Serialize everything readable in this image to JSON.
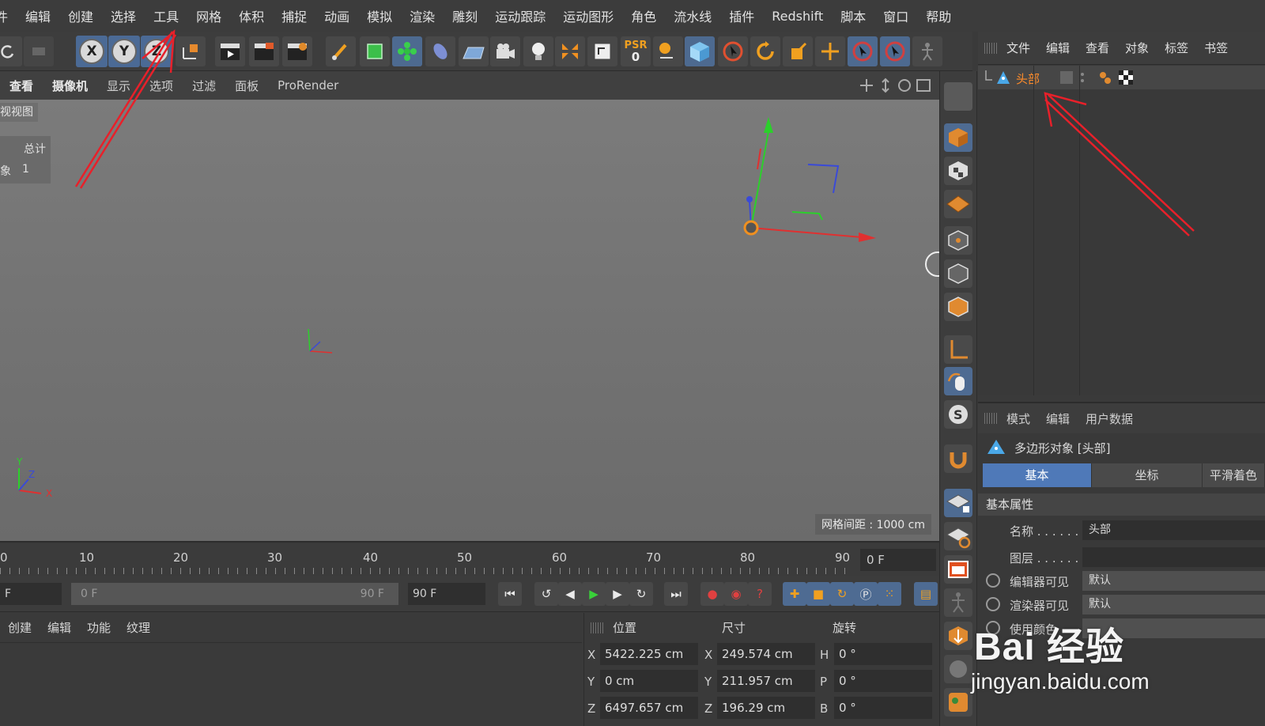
{
  "menubar": [
    "件",
    "编辑",
    "创建",
    "选择",
    "工具",
    "网格",
    "体积",
    "捕捉",
    "动画",
    "模拟",
    "渲染",
    "雕刻",
    "运动跟踪",
    "运动图形",
    "角色",
    "流水线",
    "插件",
    "Redshift",
    "脚本",
    "窗口",
    "帮助"
  ],
  "toolbar": {
    "axis_x": "X",
    "axis_y": "Y",
    "axis_z": "Z",
    "psr_label": "PSR",
    "psr_value": "0"
  },
  "viewport": {
    "menu": [
      "查看",
      "摄像机",
      "显示",
      "选项",
      "过滤",
      "面板",
      "ProRender"
    ],
    "label": "视视图",
    "hud_total": "总计",
    "hud_object": "象",
    "hud_count": "1",
    "grid_spacing": "网格间距 : 1000 cm"
  },
  "object_manager": {
    "menu": [
      "文件",
      "编辑",
      "查看",
      "对象",
      "标签",
      "书签"
    ],
    "object_name": "头部"
  },
  "attribute_manager": {
    "menu": [
      "模式",
      "编辑",
      "用户数据"
    ],
    "title": "多边形对象 [头部]",
    "tabs": [
      "基本",
      "坐标",
      "平滑着色"
    ],
    "section": "基本属性",
    "rows": [
      {
        "label": "名称 . . . . . .",
        "value": "头部"
      },
      {
        "label": "图层 . . . . . .",
        "value": ""
      },
      {
        "label": "编辑器可见",
        "value": "默认"
      },
      {
        "label": "渲染器可见",
        "value": "默认"
      },
      {
        "label": "使用颜色",
        "value": ""
      }
    ]
  },
  "timeline": {
    "ticks": [
      "0",
      "10",
      "20",
      "30",
      "40",
      "50",
      "60",
      "70",
      "80",
      "90"
    ],
    "current_frame": "0 F"
  },
  "transport": {
    "start": "F",
    "range_start": "0 F",
    "range_end": "90 F",
    "end": "90 F"
  },
  "material_manager": {
    "menu": [
      "创建",
      "编辑",
      "功能",
      "纹理"
    ]
  },
  "coordinate_manager": {
    "headers": [
      "位置",
      "尺寸",
      "旋转"
    ],
    "position": {
      "x": "5422.225 cm",
      "y": "0 cm",
      "z": "6497.657 cm"
    },
    "size": {
      "x": "249.574 cm",
      "y": "211.957 cm",
      "z": "196.29 cm"
    },
    "rotation": {
      "h": "0 °",
      "p": "0 °",
      "b": "0 °"
    },
    "axis_labels": {
      "x": "X",
      "y": "Y",
      "z": "Z",
      "h": "H",
      "p": "P",
      "b": "B"
    }
  },
  "watermark": {
    "brand": "Bai 经验",
    "url": "jingyan.baidu.com"
  },
  "colors": {
    "accent_blue": "#4f79b8",
    "object_orange": "#ff8c2a",
    "arrow_red": "#e8202a"
  }
}
